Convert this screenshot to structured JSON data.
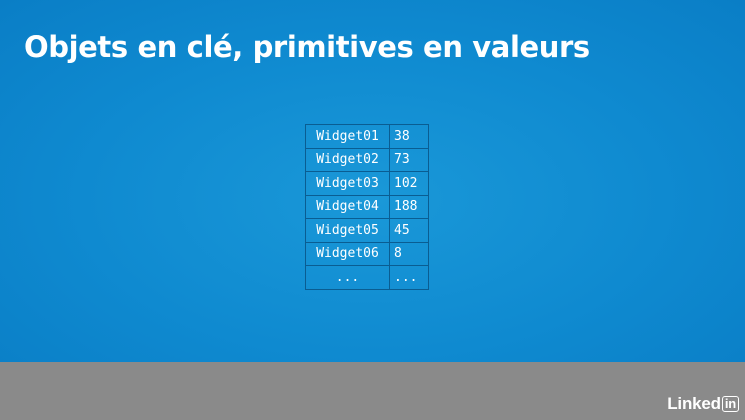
{
  "slide": {
    "title": "Objets en clé, primitives en valeurs",
    "table": {
      "rows": [
        {
          "key": "Widget01",
          "value": "38"
        },
        {
          "key": "Widget02",
          "value": "73"
        },
        {
          "key": "Widget03",
          "value": "102"
        },
        {
          "key": "Widget04",
          "value": "188"
        },
        {
          "key": "Widget05",
          "value": "45"
        },
        {
          "key": "Widget06",
          "value": "8"
        },
        {
          "key": "...",
          "value": "..."
        }
      ]
    }
  },
  "footer": {
    "brand_text": "Linked",
    "brand_box_text": "in"
  },
  "colors": {
    "slide_background": "#1190d4",
    "footer_background": "#8a8a8a",
    "table_border": "#0a5d92",
    "text": "#ffffff"
  }
}
